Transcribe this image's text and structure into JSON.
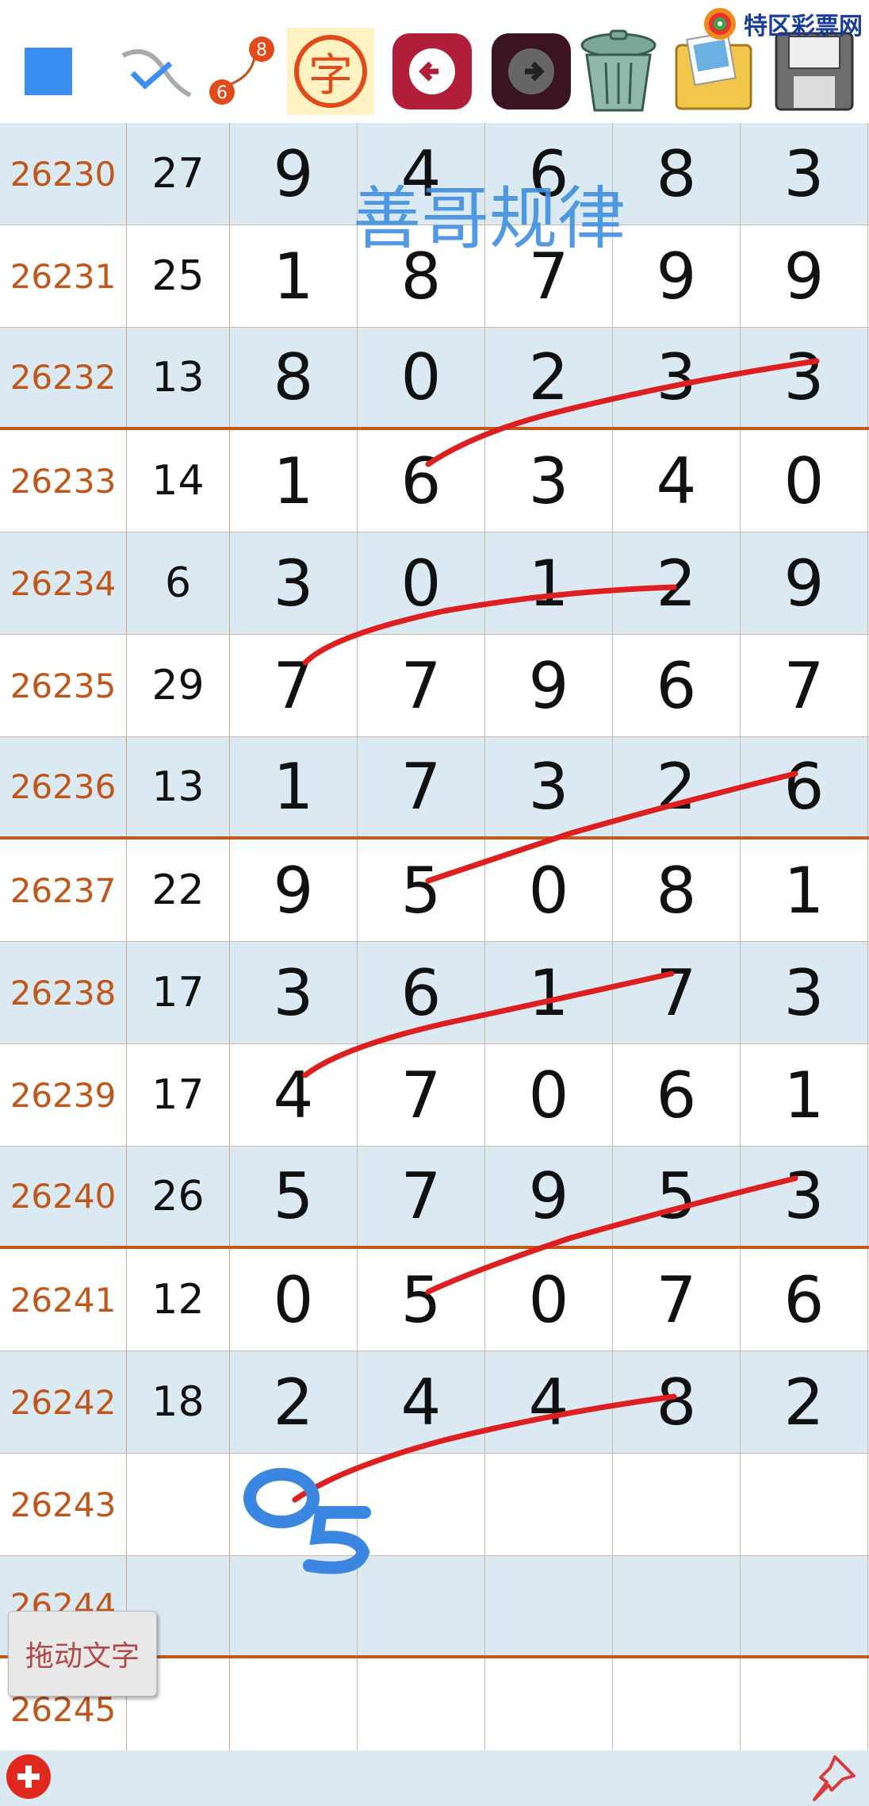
{
  "toolbar": {
    "char_label": "字",
    "pencil_numbers": [
      "8",
      "6"
    ],
    "items": [
      "color-square",
      "pen",
      "line-number-tool",
      "char-tool",
      "back-arrow",
      "forward-arrow",
      "trash",
      "photos",
      "save"
    ]
  },
  "logo": {
    "text": "特区彩票网"
  },
  "watermark": "善哥规律",
  "handwriting": {
    "digits": "05"
  },
  "drag_button": "拖动文字",
  "colors": {
    "issue_text": "#c0561a",
    "alt_row": "#dbe9f3",
    "divider": "#c05a1a",
    "red_ink": "#dd1f1f",
    "blue_ink": "#3a86e0"
  },
  "rows": [
    {
      "issue": "26230",
      "sum": "27",
      "d": [
        "9",
        "4",
        "6",
        "8",
        "3"
      ]
    },
    {
      "issue": "26231",
      "sum": "25",
      "d": [
        "1",
        "8",
        "7",
        "9",
        "9"
      ]
    },
    {
      "issue": "26232",
      "sum": "13",
      "d": [
        "8",
        "0",
        "2",
        "3",
        "3"
      ]
    },
    {
      "issue": "26233",
      "sum": "14",
      "d": [
        "1",
        "6",
        "3",
        "4",
        "0"
      ]
    },
    {
      "issue": "26234",
      "sum": "6",
      "d": [
        "3",
        "0",
        "1",
        "2",
        "9"
      ]
    },
    {
      "issue": "26235",
      "sum": "29",
      "d": [
        "7",
        "7",
        "9",
        "6",
        "7"
      ]
    },
    {
      "issue": "26236",
      "sum": "13",
      "d": [
        "1",
        "7",
        "3",
        "2",
        "6"
      ]
    },
    {
      "issue": "26237",
      "sum": "22",
      "d": [
        "9",
        "5",
        "0",
        "8",
        "1"
      ]
    },
    {
      "issue": "26238",
      "sum": "17",
      "d": [
        "3",
        "6",
        "1",
        "7",
        "3"
      ]
    },
    {
      "issue": "26239",
      "sum": "17",
      "d": [
        "4",
        "7",
        "0",
        "6",
        "1"
      ]
    },
    {
      "issue": "26240",
      "sum": "26",
      "d": [
        "5",
        "7",
        "9",
        "5",
        "3"
      ]
    },
    {
      "issue": "26241",
      "sum": "12",
      "d": [
        "0",
        "5",
        "0",
        "7",
        "6"
      ]
    },
    {
      "issue": "26242",
      "sum": "18",
      "d": [
        "2",
        "4",
        "4",
        "8",
        "2"
      ]
    },
    {
      "issue": "26243",
      "sum": "",
      "d": [
        "",
        "",
        "",
        "",
        ""
      ]
    },
    {
      "issue": "26244",
      "sum": "",
      "d": [
        "",
        "",
        "",
        "",
        ""
      ]
    },
    {
      "issue": "26245",
      "sum": "",
      "d": [
        "",
        "",
        "",
        "",
        ""
      ]
    }
  ]
}
